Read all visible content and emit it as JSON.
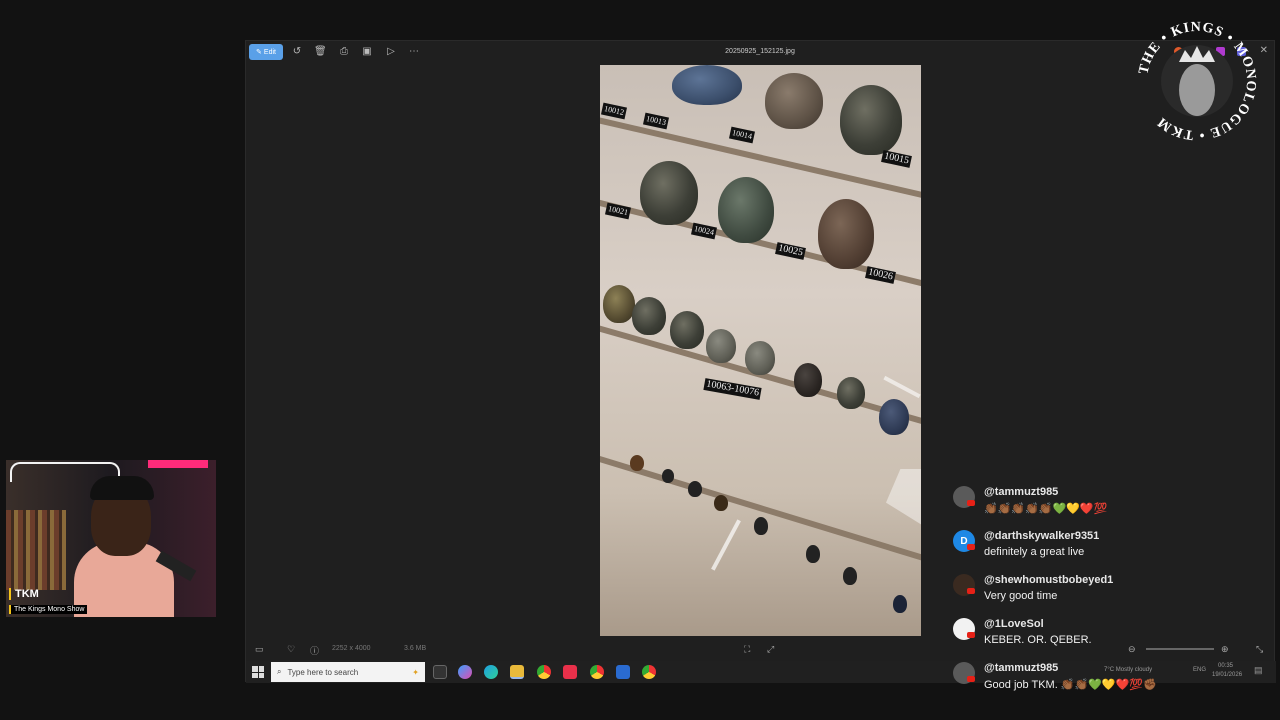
{
  "photos_window": {
    "toolbar": {
      "edit_label": "Edit",
      "file_title": "20250925_152125.jpg",
      "tools": [
        "rotate-icon",
        "delete-icon",
        "print-icon",
        "crop-icon",
        "slideshow-icon",
        "more-icon"
      ]
    },
    "photo_labels": {
      "l1": "10012",
      "l2": "10013",
      "l3": "10014",
      "l4": "10015",
      "l5": "10021",
      "l6": "10024",
      "l7": "10025",
      "l8": "10026",
      "range": "10063-10076"
    },
    "bottom_bar": {
      "dimensions": "2252 x 4000",
      "file_size": "3.6 MB"
    },
    "taskbar": {
      "search_placeholder": "Type here to search",
      "weather": "7°C  Mostly cloudy",
      "language": "ENG",
      "time": "00:35",
      "date": "19/01/2026"
    }
  },
  "webcam": {
    "name": "TKM",
    "show": "The Kings Mono Show"
  },
  "logo": {
    "text": "THE • KINGS • MONOLOGUE • TKM"
  },
  "chat": [
    {
      "author": "@tammuzt985",
      "text": "👏🏾👏🏾👏🏾👏🏾👏🏾💚💛❤️💯",
      "avatar_color": "#5a5a5a",
      "initial": ""
    },
    {
      "author": "@darthskywalker9351",
      "text": "definitely a great live",
      "avatar_color": "#1e88e5",
      "initial": "D"
    },
    {
      "author": "@shewhomustbobeyed1",
      "text": "Very good time",
      "avatar_color": "#3a2a20",
      "initial": ""
    },
    {
      "author": "@1LoveSol",
      "text": "KEBER. OR. QEBER.",
      "avatar_color": "#f2f2f2",
      "initial": ""
    },
    {
      "author": "@tammuzt985",
      "text": "Good job TKM. 👏🏾👏🏾💚💛❤️💯✊🏾",
      "avatar_color": "#5a5a5a",
      "initial": ""
    }
  ]
}
